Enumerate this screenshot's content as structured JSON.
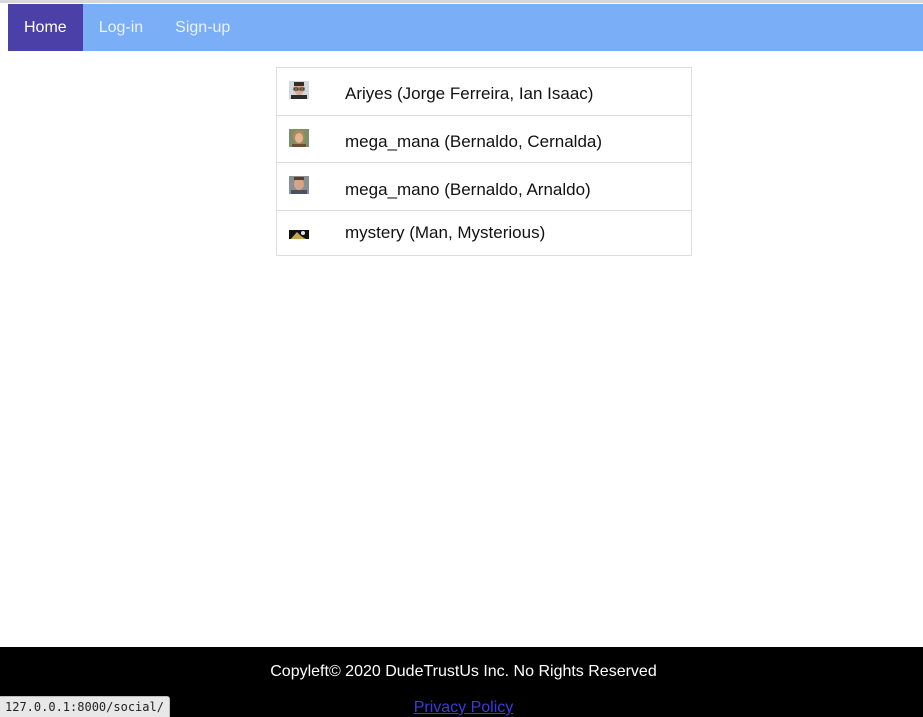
{
  "nav": {
    "items": [
      {
        "label": "Home",
        "active": true
      },
      {
        "label": "Log-in",
        "active": false
      },
      {
        "label": "Sign-up",
        "active": false
      }
    ]
  },
  "users": [
    {
      "name": "Ariyes (Jorge Ferreira, Ian Isaac)",
      "avatar": "man-glasses-portrait-icon"
    },
    {
      "name": "mega_mana (Bernaldo, Cernalda)",
      "avatar": "woman-portrait-icon"
    },
    {
      "name": "mega_mano (Bernaldo, Arnaldo)",
      "avatar": "man-portrait-icon"
    },
    {
      "name": "mystery (Man, Mysterious)",
      "avatar": "mystery-silhouette-icon"
    }
  ],
  "footer": {
    "copyright": "Copyleft© 2020 DudeTrustUs Inc. No Rights Reserved",
    "privacy_link": "Privacy Policy"
  },
  "status_bar": {
    "url": "127.0.0.1:8000/social/"
  },
  "colors": {
    "navbar": "#7aaef7",
    "nav_active": "#4b3fa8",
    "footer_bg": "#000000",
    "link": "#3b3bdc"
  }
}
